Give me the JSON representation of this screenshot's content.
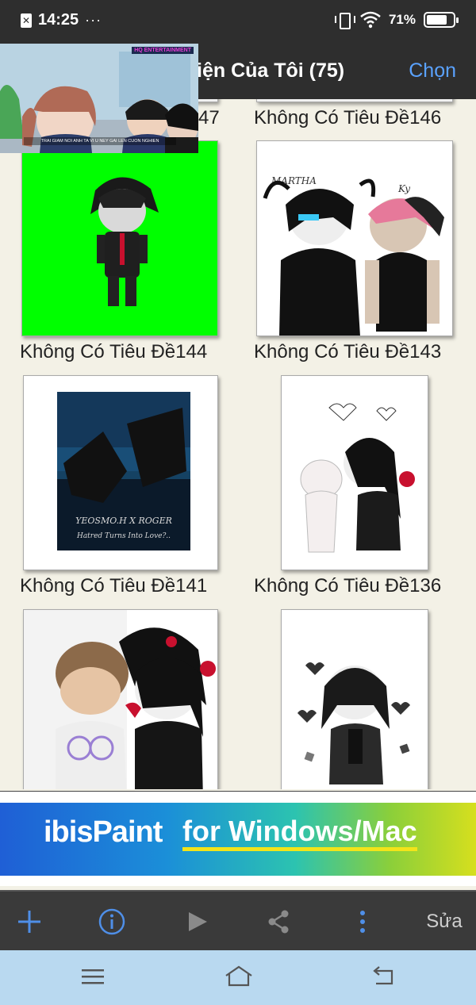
{
  "status_bar": {
    "time": "14:25",
    "more_indicator": "···",
    "battery_percent": "71%",
    "battery_level": 0.71,
    "icons": [
      "sim-off-icon",
      "vibrate-icon",
      "wifi-icon",
      "battery-icon"
    ]
  },
  "header": {
    "title_visible": "iện Của Tôi (75)",
    "select_label": "Chọn"
  },
  "video_overlay": {
    "channel_tag": "HQ ENTERTAINMENT",
    "subtitle": "TRAI GIAM NOI ANH TA VI U NEY GAI LEN CUON NGHIEN"
  },
  "gallery": {
    "items": [
      {
        "label": "47",
        "partial": true
      },
      {
        "label": "Không Có Tiêu Đề146"
      },
      {
        "label": "Không Có Tiêu Đề144"
      },
      {
        "label": "Không Có Tiêu Đề143"
      },
      {
        "label": "Không Có Tiêu Đề141",
        "art_caption": "YEOSMO.H X ROGER",
        "art_subcaption": "Hatred Turns Into Love?.."
      },
      {
        "label": "Không Có Tiêu Đề136"
      },
      {
        "label": "",
        "partial": true
      },
      {
        "label": "",
        "partial": true
      }
    ],
    "martha_text": "MARTHA",
    "ky_text": "Ky"
  },
  "ad": {
    "brand": "ibisPaint",
    "platform": "for Windows/Mac"
  },
  "toolbar": {
    "edit_label": "Sửa",
    "icons": [
      "add-icon",
      "info-icon",
      "play-icon",
      "share-icon",
      "more-vertical-icon"
    ]
  },
  "colors": {
    "accent": "#5aa2ff",
    "toolbar_icon": "#4f8fe8",
    "background": "#f3f1e6",
    "header": "#2e2e2e",
    "navbar": "#b9d9f0"
  }
}
